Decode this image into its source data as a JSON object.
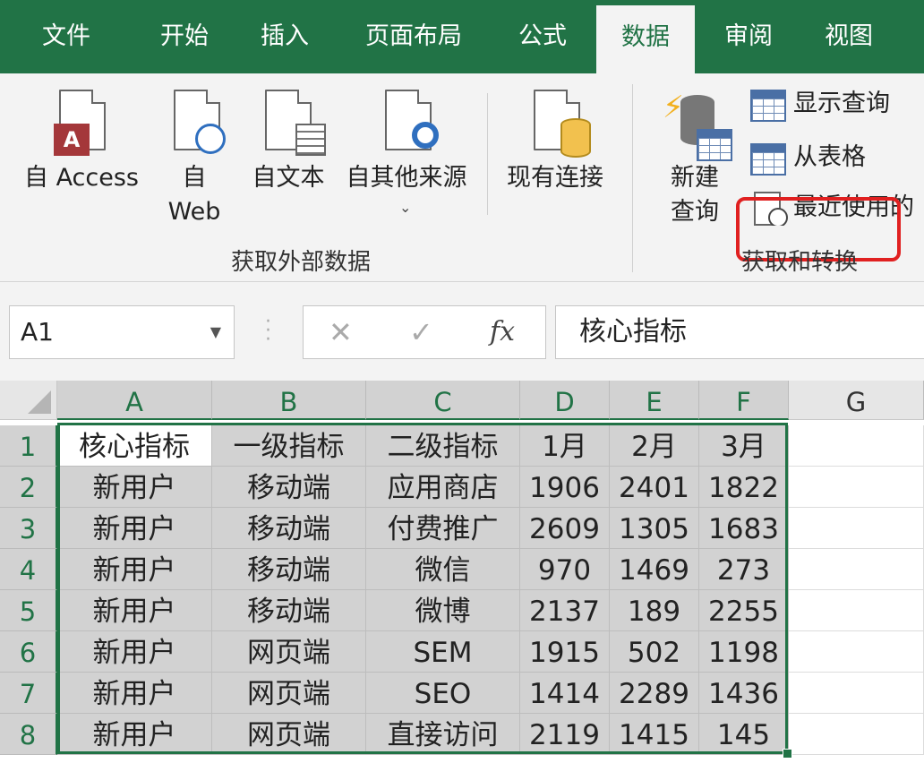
{
  "tabs": [
    "文件",
    "开始",
    "插入",
    "页面布局",
    "公式",
    "数据",
    "审阅",
    "视图"
  ],
  "active_tab": "数据",
  "ribbon": {
    "get_external": {
      "from_access": "自 Access",
      "from_web_1": "自",
      "from_web_2": "Web",
      "from_text": "自文本",
      "from_other": "自其他来源",
      "existing_conn": "现有连接",
      "group_label": "获取外部数据"
    },
    "get_transform": {
      "new_query_1": "新建",
      "new_query_2": "查询",
      "show_queries": "显示查询",
      "from_table": "从表格",
      "recent_sources": "最近使用的",
      "group_label": "获取和转换"
    }
  },
  "formula_bar": {
    "name_box": "A1",
    "cancel": "✕",
    "enter": "✓",
    "fx": "fx",
    "content": "核心指标"
  },
  "sheet": {
    "columns": [
      "A",
      "B",
      "C",
      "D",
      "E",
      "F",
      "G"
    ],
    "row_numbers": [
      "1",
      "2",
      "3",
      "4",
      "5",
      "6",
      "7",
      "8"
    ],
    "rows": [
      [
        "核心指标",
        "一级指标",
        "二级指标",
        "1月",
        "2月",
        "3月"
      ],
      [
        "新用户",
        "移动端",
        "应用商店",
        "1906",
        "2401",
        "1822"
      ],
      [
        "新用户",
        "移动端",
        "付费推广",
        "2609",
        "1305",
        "1683"
      ],
      [
        "新用户",
        "移动端",
        "微信",
        "970",
        "1469",
        "273"
      ],
      [
        "新用户",
        "移动端",
        "微博",
        "2137",
        "189",
        "2255"
      ],
      [
        "新用户",
        "网页端",
        "SEM",
        "1915",
        "502",
        "1198"
      ],
      [
        "新用户",
        "网页端",
        "SEO",
        "1414",
        "2289",
        "1436"
      ],
      [
        "新用户",
        "网页端",
        "直接访问",
        "2119",
        "1415",
        "145"
      ]
    ]
  },
  "colors": {
    "excel_green": "#217346",
    "highlight_red": "#e02020"
  }
}
